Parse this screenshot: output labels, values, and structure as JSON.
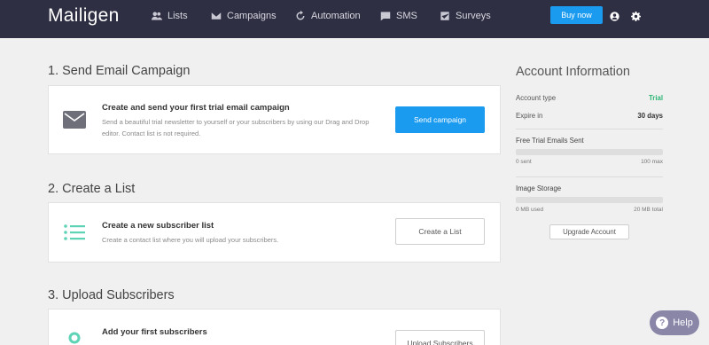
{
  "header": {
    "logo": "Mailigen",
    "nav": [
      {
        "label": "Lists",
        "icon": "people-icon"
      },
      {
        "label": "Campaigns",
        "icon": "envelope-icon"
      },
      {
        "label": "Automation",
        "icon": "refresh-icon"
      },
      {
        "label": "SMS",
        "icon": "chat-icon"
      },
      {
        "label": "Surveys",
        "icon": "checkbox-icon"
      }
    ],
    "buy_label": "Buy now",
    "colors": {
      "bar": "#2f2f44",
      "accent": "#1a9bf0"
    }
  },
  "sections": {
    "email": {
      "title": "1. Send Email Campaign",
      "heading": "Create and send your first trial email campaign",
      "description": "Send a beautiful trial newsletter to yourself or your subscribers by using our Drag and Drop editor. Contact list is not required.",
      "button": "Send campaign",
      "icon": "envelope-icon"
    },
    "list": {
      "title": "2. Create a List",
      "heading": "Create a new subscriber list",
      "description": "Create a contact list where you will upload your subscribers.",
      "button": "Create a List",
      "icon": "list-icon"
    },
    "upload": {
      "title": "3. Upload Subscribers",
      "heading": "Add your first subscribers",
      "button": "Upload Subscribers",
      "icon": "circle-icon"
    }
  },
  "account": {
    "title": "Account Information",
    "type_label": "Account type",
    "type_value": "Trial",
    "expire_label": "Expire in",
    "expire_value": "30 days",
    "emails_label": "Free Trial Emails Sent",
    "emails_min": "0 sent",
    "emails_max": "100 max",
    "emails_fraction": 0,
    "storage_label": "Image Storage",
    "storage_min": "0 MB used",
    "storage_max": "20 MB total",
    "storage_fraction": 0,
    "upgrade_label": "Upgrade Account",
    "trial_color": "#2bb673"
  },
  "help": {
    "label": "Help"
  }
}
